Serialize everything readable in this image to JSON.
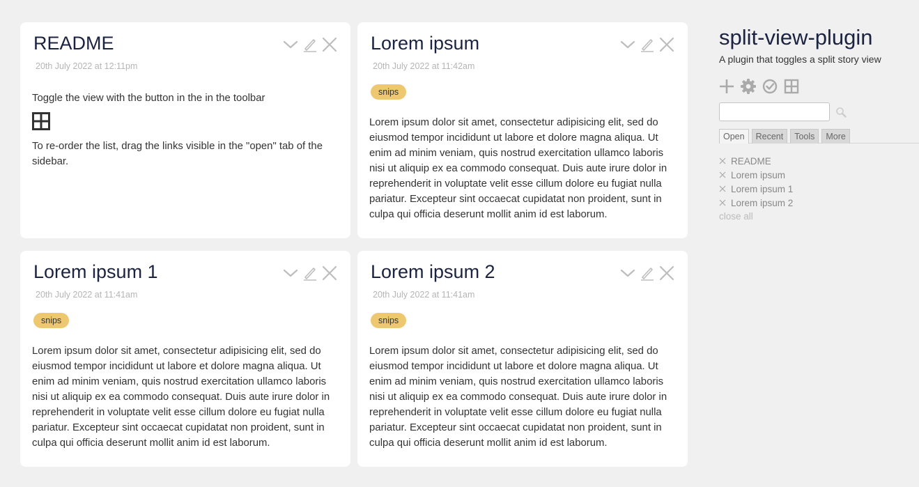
{
  "tiddlers": [
    {
      "title": "README",
      "subtitle": "20th July 2022 at 12:11pm",
      "body_p1": "Toggle the view with the button in the in the toolbar",
      "body_p2": "To re-order the list, drag the links visible in the \"open\" tab of the sidebar."
    },
    {
      "title": "Lorem ipsum",
      "subtitle": "20th July 2022 at 11:42am",
      "tag": "snips",
      "body": "Lorem ipsum dolor sit amet, consectetur adipisicing elit, sed do eiusmod tempor incididunt ut labore et dolore magna aliqua. Ut enim ad minim veniam, quis nostrud exercitation ullamco laboris nisi ut aliquip ex ea commodo consequat. Duis aute irure dolor in reprehenderit in voluptate velit esse cillum dolore eu fugiat nulla pariatur. Excepteur sint occaecat cupidatat non proident, sunt in culpa qui officia deserunt mollit anim id est laborum."
    },
    {
      "title": "Lorem ipsum 1",
      "subtitle": "20th July 2022 at 11:41am",
      "tag": "snips",
      "body": "Lorem ipsum dolor sit amet, consectetur adipisicing elit, sed do eiusmod tempor incididunt ut labore et dolore magna aliqua. Ut enim ad minim veniam, quis nostrud exercitation ullamco laboris nisi ut aliquip ex ea commodo consequat. Duis aute irure dolor in reprehenderit in voluptate velit esse cillum dolore eu fugiat nulla pariatur. Excepteur sint occaecat cupidatat non proident, sunt in culpa qui officia deserunt mollit anim id est laborum."
    },
    {
      "title": "Lorem ipsum 2",
      "subtitle": "20th July 2022 at 11:41am",
      "tag": "snips",
      "body": "Lorem ipsum dolor sit amet, consectetur adipisicing elit, sed do eiusmod tempor incididunt ut labore et dolore magna aliqua. Ut enim ad minim veniam, quis nostrud exercitation ullamco laboris nisi ut aliquip ex ea commodo consequat. Duis aute irure dolor in reprehenderit in voluptate velit esse cillum dolore eu fugiat nulla pariatur. Excepteur sint occaecat cupidatat non proident, sunt in culpa qui officia deserunt mollit anim id est laborum."
    }
  ],
  "sidebar": {
    "title": "split-view-plugin",
    "subtitle": "A plugin that toggles a split story view",
    "buttons": [
      "plus-icon",
      "gear-icon",
      "check-circle-icon",
      "split-view-icon"
    ],
    "search": {
      "value": "",
      "placeholder": ""
    },
    "tabs": [
      {
        "label": "Open",
        "active": true
      },
      {
        "label": "Recent",
        "active": false
      },
      {
        "label": "Tools",
        "active": false
      },
      {
        "label": "More",
        "active": false
      }
    ],
    "open_items": [
      "README",
      "Lorem ipsum",
      "Lorem ipsum 1",
      "Lorem ipsum 2"
    ],
    "close_all": "close all"
  },
  "colors": {
    "background": "#f0f0f0",
    "card": "#ffffff",
    "title": "#1b2340",
    "tag": "#edc870",
    "muted": "#b5b5b5"
  }
}
